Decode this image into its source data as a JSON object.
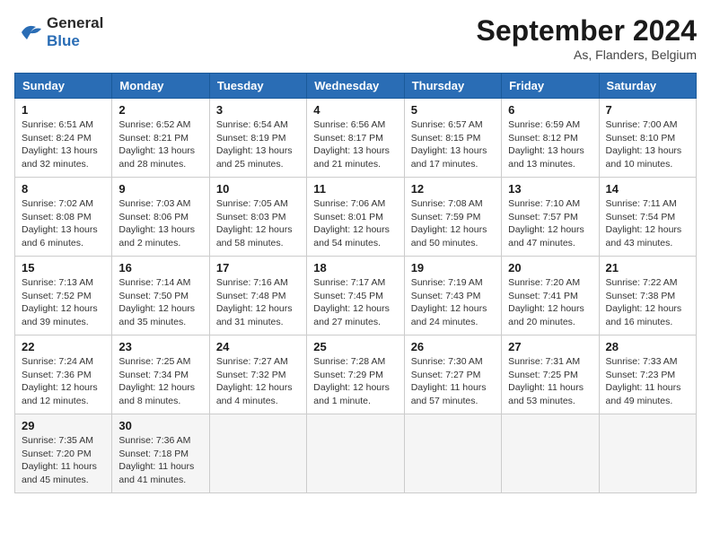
{
  "header": {
    "logo_line1": "General",
    "logo_line2": "Blue",
    "month_title": "September 2024",
    "location": "As, Flanders, Belgium"
  },
  "weekdays": [
    "Sunday",
    "Monday",
    "Tuesday",
    "Wednesday",
    "Thursday",
    "Friday",
    "Saturday"
  ],
  "weeks": [
    [
      {
        "day": "1",
        "sunrise": "6:51 AM",
        "sunset": "8:24 PM",
        "daylight": "13 hours and 32 minutes."
      },
      {
        "day": "2",
        "sunrise": "6:52 AM",
        "sunset": "8:21 PM",
        "daylight": "13 hours and 28 minutes."
      },
      {
        "day": "3",
        "sunrise": "6:54 AM",
        "sunset": "8:19 PM",
        "daylight": "13 hours and 25 minutes."
      },
      {
        "day": "4",
        "sunrise": "6:56 AM",
        "sunset": "8:17 PM",
        "daylight": "13 hours and 21 minutes."
      },
      {
        "day": "5",
        "sunrise": "6:57 AM",
        "sunset": "8:15 PM",
        "daylight": "13 hours and 17 minutes."
      },
      {
        "day": "6",
        "sunrise": "6:59 AM",
        "sunset": "8:12 PM",
        "daylight": "13 hours and 13 minutes."
      },
      {
        "day": "7",
        "sunrise": "7:00 AM",
        "sunset": "8:10 PM",
        "daylight": "13 hours and 10 minutes."
      }
    ],
    [
      {
        "day": "8",
        "sunrise": "7:02 AM",
        "sunset": "8:08 PM",
        "daylight": "13 hours and 6 minutes."
      },
      {
        "day": "9",
        "sunrise": "7:03 AM",
        "sunset": "8:06 PM",
        "daylight": "13 hours and 2 minutes."
      },
      {
        "day": "10",
        "sunrise": "7:05 AM",
        "sunset": "8:03 PM",
        "daylight": "12 hours and 58 minutes."
      },
      {
        "day": "11",
        "sunrise": "7:06 AM",
        "sunset": "8:01 PM",
        "daylight": "12 hours and 54 minutes."
      },
      {
        "day": "12",
        "sunrise": "7:08 AM",
        "sunset": "7:59 PM",
        "daylight": "12 hours and 50 minutes."
      },
      {
        "day": "13",
        "sunrise": "7:10 AM",
        "sunset": "7:57 PM",
        "daylight": "12 hours and 47 minutes."
      },
      {
        "day": "14",
        "sunrise": "7:11 AM",
        "sunset": "7:54 PM",
        "daylight": "12 hours and 43 minutes."
      }
    ],
    [
      {
        "day": "15",
        "sunrise": "7:13 AM",
        "sunset": "7:52 PM",
        "daylight": "12 hours and 39 minutes."
      },
      {
        "day": "16",
        "sunrise": "7:14 AM",
        "sunset": "7:50 PM",
        "daylight": "12 hours and 35 minutes."
      },
      {
        "day": "17",
        "sunrise": "7:16 AM",
        "sunset": "7:48 PM",
        "daylight": "12 hours and 31 minutes."
      },
      {
        "day": "18",
        "sunrise": "7:17 AM",
        "sunset": "7:45 PM",
        "daylight": "12 hours and 27 minutes."
      },
      {
        "day": "19",
        "sunrise": "7:19 AM",
        "sunset": "7:43 PM",
        "daylight": "12 hours and 24 minutes."
      },
      {
        "day": "20",
        "sunrise": "7:20 AM",
        "sunset": "7:41 PM",
        "daylight": "12 hours and 20 minutes."
      },
      {
        "day": "21",
        "sunrise": "7:22 AM",
        "sunset": "7:38 PM",
        "daylight": "12 hours and 16 minutes."
      }
    ],
    [
      {
        "day": "22",
        "sunrise": "7:24 AM",
        "sunset": "7:36 PM",
        "daylight": "12 hours and 12 minutes."
      },
      {
        "day": "23",
        "sunrise": "7:25 AM",
        "sunset": "7:34 PM",
        "daylight": "12 hours and 8 minutes."
      },
      {
        "day": "24",
        "sunrise": "7:27 AM",
        "sunset": "7:32 PM",
        "daylight": "12 hours and 4 minutes."
      },
      {
        "day": "25",
        "sunrise": "7:28 AM",
        "sunset": "7:29 PM",
        "daylight": "12 hours and 1 minute."
      },
      {
        "day": "26",
        "sunrise": "7:30 AM",
        "sunset": "7:27 PM",
        "daylight": "11 hours and 57 minutes."
      },
      {
        "day": "27",
        "sunrise": "7:31 AM",
        "sunset": "7:25 PM",
        "daylight": "11 hours and 53 minutes."
      },
      {
        "day": "28",
        "sunrise": "7:33 AM",
        "sunset": "7:23 PM",
        "daylight": "11 hours and 49 minutes."
      }
    ],
    [
      {
        "day": "29",
        "sunrise": "7:35 AM",
        "sunset": "7:20 PM",
        "daylight": "11 hours and 45 minutes."
      },
      {
        "day": "30",
        "sunrise": "7:36 AM",
        "sunset": "7:18 PM",
        "daylight": "11 hours and 41 minutes."
      },
      null,
      null,
      null,
      null,
      null
    ]
  ]
}
